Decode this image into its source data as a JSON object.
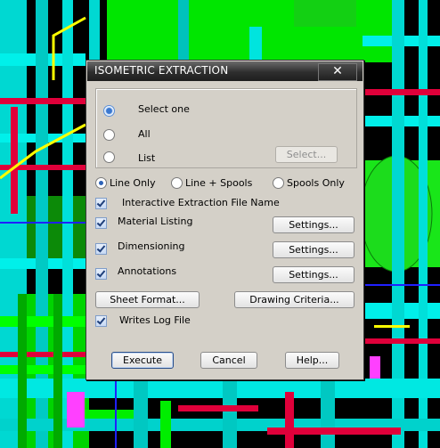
{
  "dialog": {
    "title": "ISOMETRIC EXTRACTION",
    "close_glyph": "✕",
    "selection": {
      "options": [
        "Select one",
        "All",
        "List"
      ],
      "selected": "Select one",
      "select_button": "Select..."
    },
    "mode": {
      "options": [
        "Line Only",
        "Line + Spools",
        "Spools Only"
      ],
      "selected": "Line Only"
    },
    "interactive_extraction": {
      "label": "Interactive Extraction File Name",
      "checked": true
    },
    "material_listing": {
      "label": "Material Listing",
      "checked": true,
      "settings": "Settings..."
    },
    "dimensioning": {
      "label": "Dimensioning",
      "checked": true,
      "settings": "Settings..."
    },
    "annotations": {
      "label": "Annotations",
      "checked": true,
      "settings": "Settings..."
    },
    "sheet_format_button": "Sheet Format...",
    "drawing_criteria_button": "Drawing Criteria...",
    "writes_log_file": {
      "label": "Writes Log File",
      "checked": true
    },
    "execute_button": "Execute",
    "cancel_button": "Cancel",
    "help_button": "Help..."
  },
  "colors": {
    "cyan_pipe": "#00e5e0",
    "green_pipe": "#00ee00",
    "red_pipe": "#e0003a",
    "yellow_pipe": "#ffff00",
    "dialog_face": "#d4d0c8"
  }
}
